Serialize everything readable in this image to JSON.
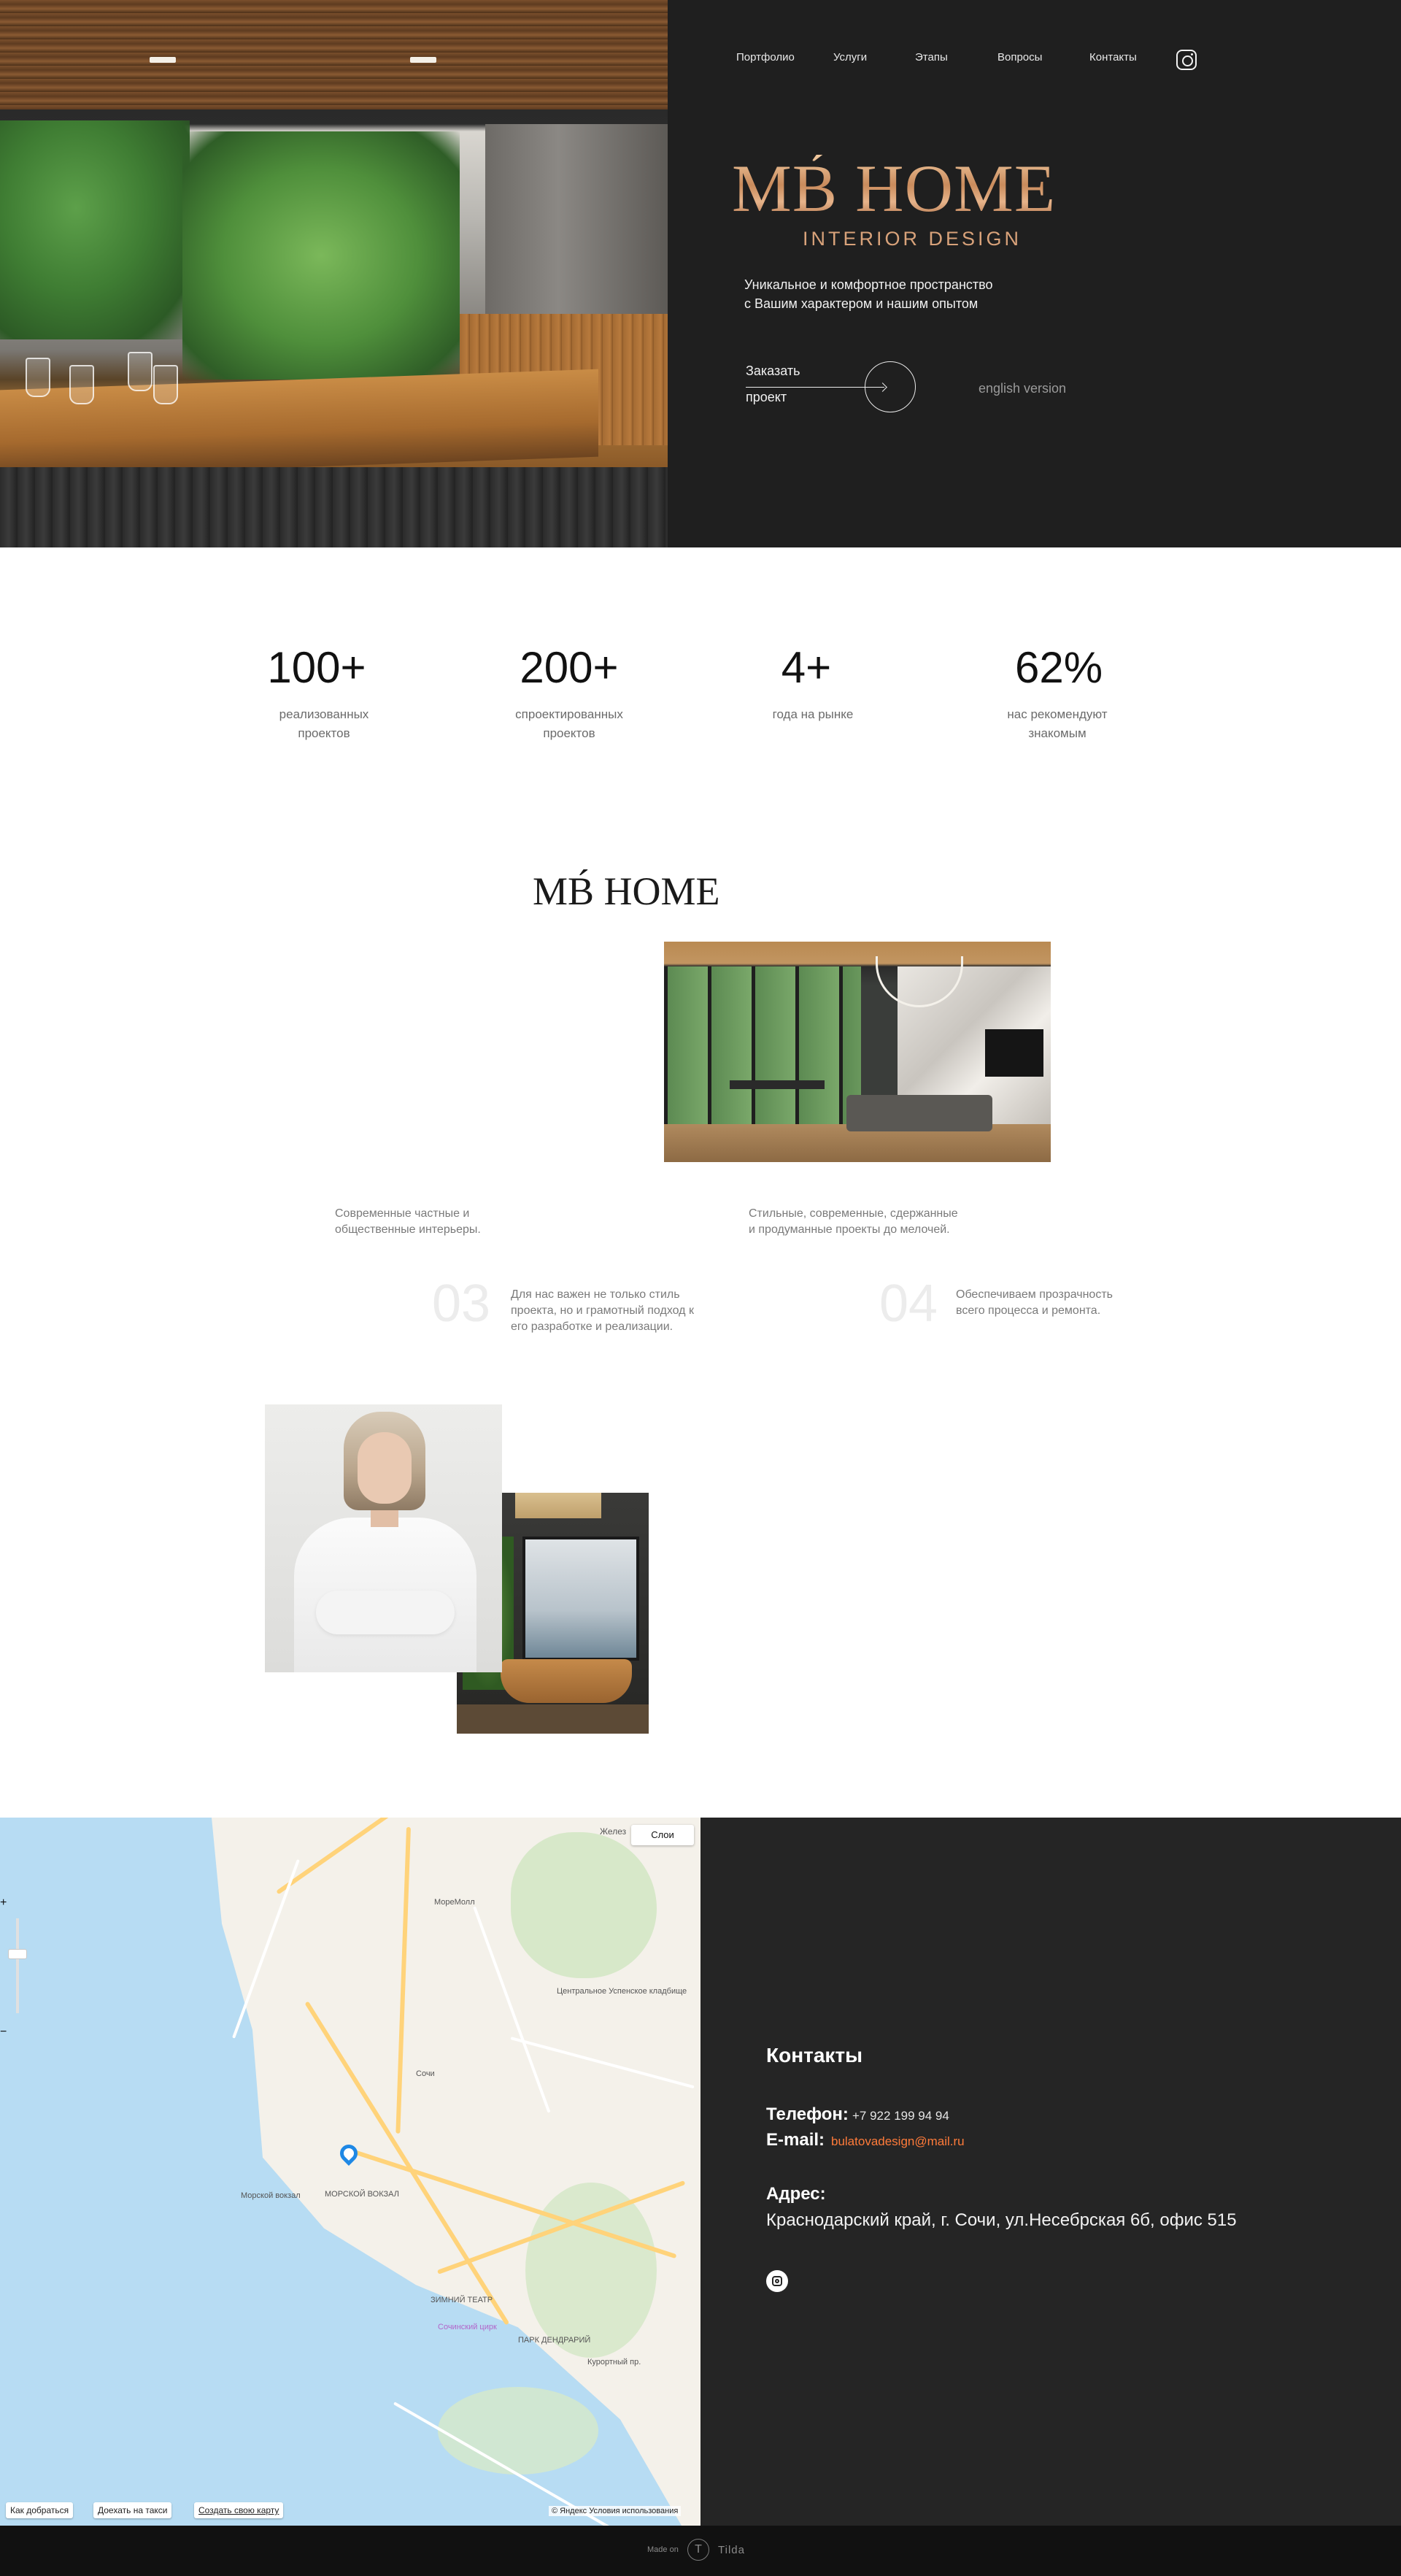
{
  "nav": {
    "items": [
      {
        "label": "Портфолио"
      },
      {
        "label": "Услуги"
      },
      {
        "label": "Этапы"
      },
      {
        "label": "Вопросы"
      },
      {
        "label": "Контакты"
      }
    ]
  },
  "hero": {
    "logo": "MB́ HOME",
    "subtitle": "INTERIOR DESIGN",
    "tagline_line1": "Уникальное и комфортное пространство",
    "tagline_line2": "с Вашим характером и нашим опытом",
    "order_line1": "Заказать",
    "order_line2": "проект",
    "english": "english version"
  },
  "stats": [
    {
      "value": "100+",
      "label_line1": "реализованных",
      "label_line2": "проектов"
    },
    {
      "value": "200+",
      "label_line1": "спроектированных",
      "label_line2": "проектов"
    },
    {
      "value": "4+",
      "label_line1": "года на рынке",
      "label_line2": ""
    },
    {
      "value": "62%",
      "label_line1": "нас рекомендуют",
      "label_line2": "знакомым"
    }
  ],
  "about": {
    "logo": "MB́ HOME",
    "item1_line1": "Современные частные и",
    "item1_line2": "общественные интерьеры.",
    "item2_line1": "Стильные, современные, сдержанные",
    "item2_line2": "и продуманные проекты до мелочей.",
    "item3_num": "03",
    "item3_line1": "Для нас важен не только стиль",
    "item3_line2": "проекта, но и грамотный подход к",
    "item3_line3": "его разработке и реализации.",
    "item4_num": "04",
    "item4_line1": "Обеспечиваем прозрачность",
    "item4_line2": "всего процесса и ремонта."
  },
  "map": {
    "zoom_in": "+",
    "zoom_out": "−",
    "layers": "Слои",
    "layer_hint": "Желез",
    "route_btn": "Как добраться",
    "taxi_btn": "Доехать на такси",
    "create_btn": "Создать свою карту",
    "copyright": "© Яндекс Условия использования",
    "labels": {
      "sea_station": "Морской вокзал",
      "sea_station2": "МОРСКОЙ ВОКЗАЛ",
      "moremall": "МореМолл",
      "sochi": "Сочи",
      "cemetery": "Центральное Успенское кладбище",
      "theatre": "ЗИМНИЙ ТЕАТР",
      "circus": "Сочинский цирк",
      "park": "ПАРК ДЕНДРАРИЙ",
      "kurortny": "Курортный пр."
    }
  },
  "contacts": {
    "title": "Контакты",
    "phone_label": "Телефон:",
    "phone_value": "+7 922 199 94 94",
    "email_label": "E-mail:",
    "email_value": "bulatovadesign@mail.ru",
    "address_label": "Адрес:",
    "address_value": "Краснодарский край, г. Сочи, ул.Несебрская 6б, офис 515"
  },
  "footer": {
    "made_on": "Made on",
    "tilda_letter": "T",
    "tilda": "Tilda"
  }
}
